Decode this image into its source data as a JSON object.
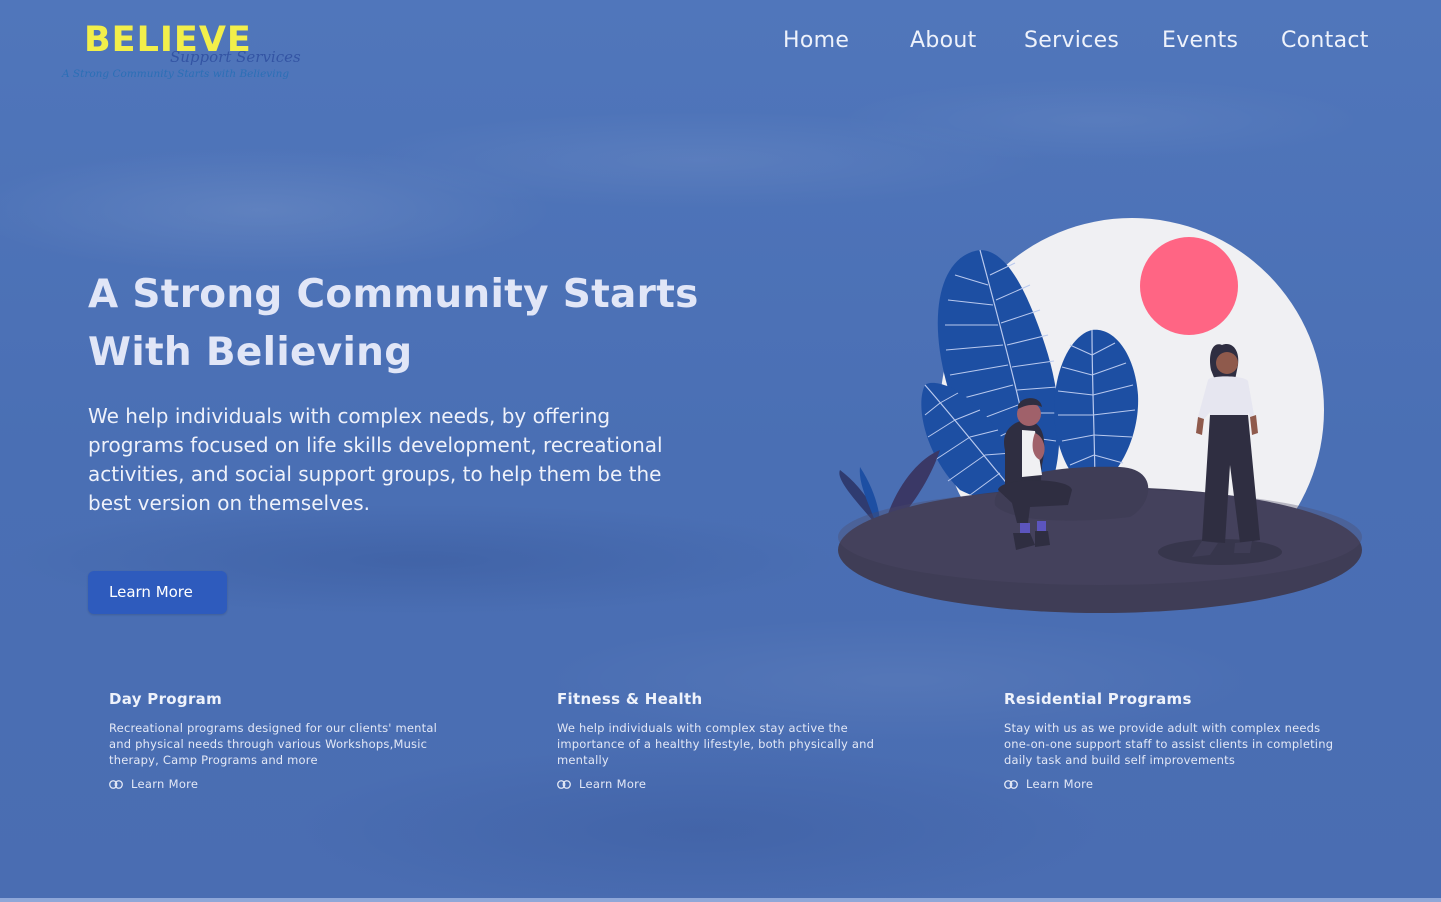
{
  "logo": {
    "main": "BELIEVE",
    "script": "Support Services",
    "tagline": "A Strong Community Starts with Believing"
  },
  "nav": {
    "items": [
      {
        "label": "Home"
      },
      {
        "label": "About"
      },
      {
        "label": "Services"
      },
      {
        "label": "Events"
      },
      {
        "label": "Contact"
      }
    ]
  },
  "hero": {
    "title_line1": "A Strong Community Starts",
    "title_line2": "With Believing",
    "description": "We help individuals with complex needs, by offering programs focused on life skills development, recreational activities, and social support groups, to help them be the best version on themselves.",
    "button_label": "Learn More"
  },
  "cards": [
    {
      "title": "Day Program",
      "text": "Recreational programs designed  for our clients' mental and physical needs through various Workshops,Music therapy, Camp Programs and more",
      "link": "Learn More"
    },
    {
      "title": "Fitness & Health",
      "text": "We help individuals with complex stay active the importance of a healthy lifestyle, both physically and mentally",
      "link": "Learn More"
    },
    {
      "title": "Residential Programs",
      "text": "Stay with us as we provide adult with complex needs one-on-one support staff to assist clients in completing daily task and build self improvements",
      "link": "Learn More"
    }
  ],
  "colors": {
    "background": "#4b6fb3",
    "logo_yellow": "#f2ef4a",
    "button": "#2e5bbd",
    "sun": "#ff6584",
    "platform": "#3f3d56"
  }
}
